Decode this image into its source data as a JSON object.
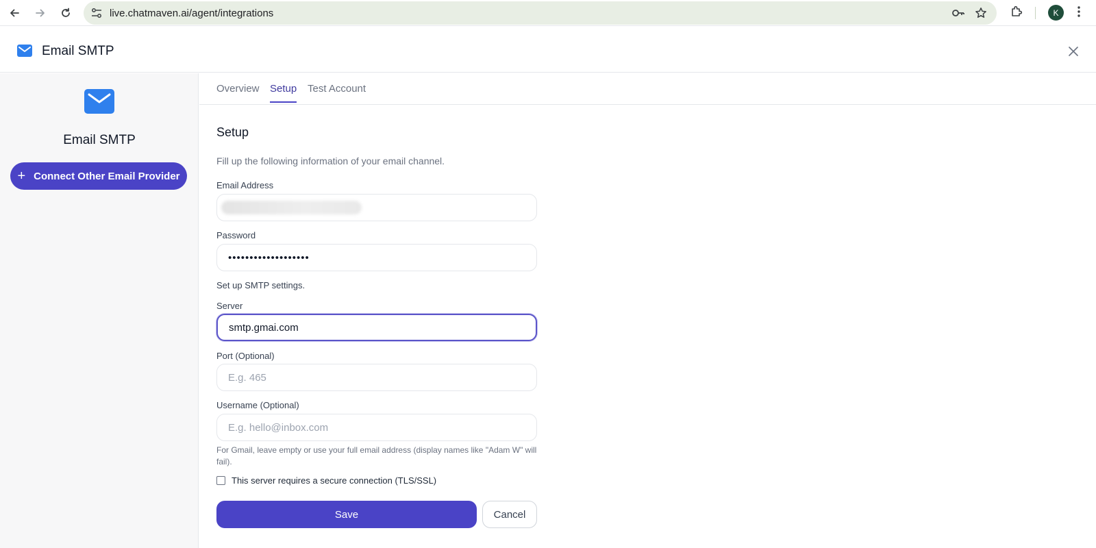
{
  "browser": {
    "url": "live.chatmaven.ai/agent/integrations",
    "profile_initial": "K"
  },
  "header": {
    "title": "Email SMTP",
    "icon": "mail-icon"
  },
  "sidebar": {
    "title": "Email SMTP",
    "connect_button_label": "Connect Other Email Provider"
  },
  "tabs": [
    {
      "label": "Overview",
      "active": false
    },
    {
      "label": "Setup",
      "active": true
    },
    {
      "label": "Test Account",
      "active": false
    }
  ],
  "form": {
    "title": "Setup",
    "description": "Fill up the following information of your email channel.",
    "email_label": "Email Address",
    "password_label": "Password",
    "password_value": "•••••••••••••••••••",
    "smtp_section_label": "Set up SMTP settings.",
    "server_label": "Server",
    "server_value": "smtp.gmai.com",
    "port_label": "Port (Optional)",
    "port_placeholder": "E.g. 465",
    "username_label": "Username (Optional)",
    "username_placeholder": "E.g. hello@inbox.com",
    "username_hint": "For Gmail, leave empty or use your full email address (display names like \"Adam W\" will fail).",
    "secure_label": "This server requires a secure connection (TLS/SSL)",
    "save_label": "Save",
    "cancel_label": "Cancel"
  },
  "colors": {
    "accent": "#4a43c6",
    "mail_icon": "#2f80ed"
  }
}
